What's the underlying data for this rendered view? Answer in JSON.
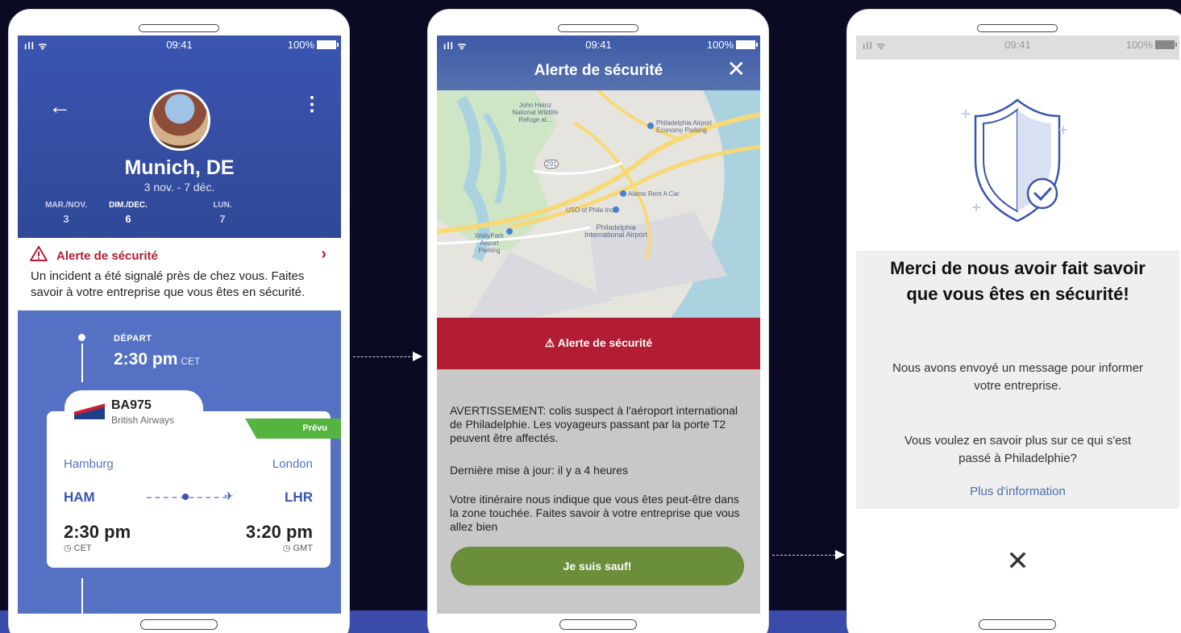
{
  "status_bar": {
    "time": "09:41",
    "battery": "100%"
  },
  "screen1": {
    "city": "Munich, DE",
    "dates": "3 nov. - 7 déc.",
    "days": [
      {
        "label": "MAR./NOV.",
        "num": "3"
      },
      {
        "label": "DIM./DEC.",
        "num": "6"
      },
      {
        "label": "LUN.",
        "num": "7"
      }
    ],
    "alert_title": "Alerte de sécurité",
    "alert_body": "Un incident a été signalé près de chez vous. Faites savoir à votre entreprise que vous êtes en sécurité.",
    "depart_label": "DÉPART",
    "depart_time": "2:30 pm",
    "depart_tz": "CET",
    "flight": {
      "number": "BA975",
      "airline": "British Airways",
      "status": "Prévu",
      "from_city": "Hamburg",
      "to_city": "London",
      "from_code": "HAM",
      "to_code": "LHR",
      "from_time": "2:30 pm",
      "to_time": "3:20 pm",
      "from_tz": "CET",
      "to_tz": "GMT"
    }
  },
  "screen2": {
    "title": "Alerte de sécurité",
    "banner": "Alerte de sécurité",
    "map_labels": {
      "refuge": "John Heinz National Wildlife Refuge at...",
      "economy": "Philadelphia Airport Economy Parking",
      "alamo": "Alamo Rent A Car",
      "uso": "USO of Phila Inc",
      "airport": "Philadelphia International Airport",
      "wallypark": "WallyPark Airport Parking",
      "route_291": "291"
    },
    "warning": "AVERTISSEMENT: colis suspect à l'aéroport international de Philadelphie. Les voyageurs passant par la porte T2 peuvent être affectés.",
    "updated": "Dernière mise à jour: il y a 4 heures",
    "itinerary": "Votre itinéraire nous indique que vous êtes peut-être dans la zone touchée. Faites savoir à votre entreprise que vous allez bien",
    "safe_button": "Je suis sauf!"
  },
  "screen3": {
    "title": "Merci de nous avoir fait savoir que vous êtes en sécurité!",
    "message": "Nous avons envoyé un message pour informer votre entreprise.",
    "question": "Vous voulez en savoir plus sur ce qui s'est passé à Philadelphie?",
    "more_link": "Plus d'information"
  },
  "colors": {
    "background": "#0a0b22",
    "primary_blue": "#3a55b1",
    "alert_red": "#b21d34",
    "safe_green": "#6a8e3a",
    "status_green": "#55b43f"
  }
}
